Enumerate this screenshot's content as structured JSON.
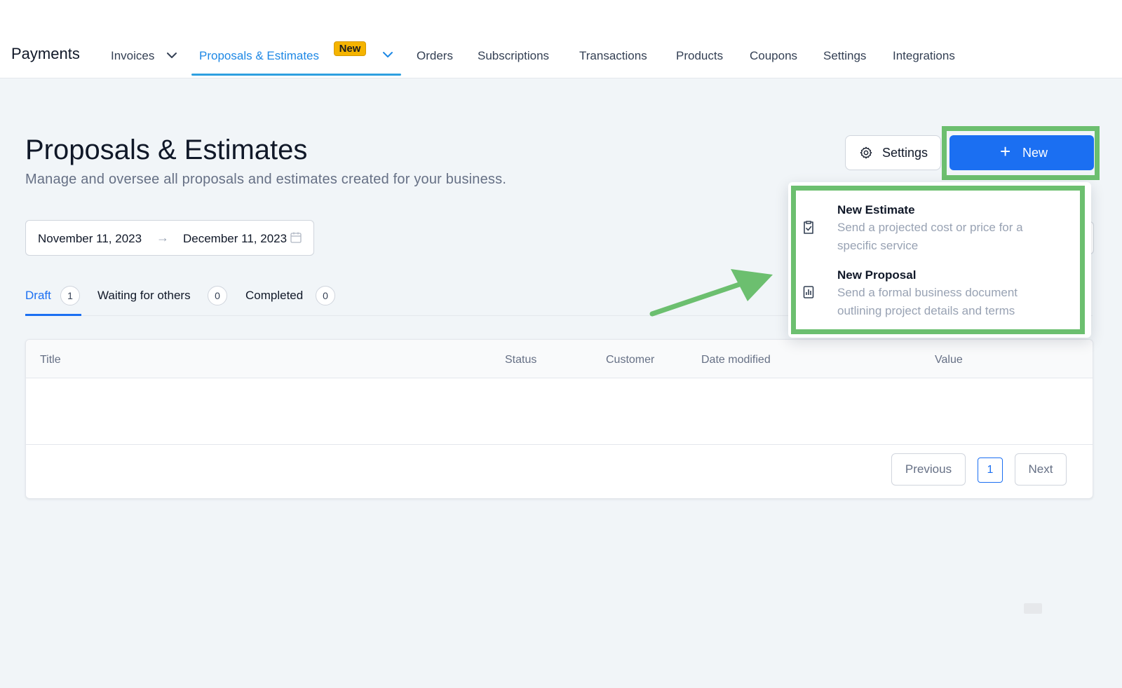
{
  "nav": {
    "brand": "Payments",
    "items": [
      {
        "label": "Invoices"
      },
      {
        "label": "Proposals & Estimates",
        "badge": "New"
      },
      {
        "label": "Orders"
      },
      {
        "label": "Subscriptions"
      },
      {
        "label": "Transactions"
      },
      {
        "label": "Products"
      },
      {
        "label": "Coupons"
      },
      {
        "label": "Settings"
      },
      {
        "label": "Integrations"
      }
    ],
    "active_index": 1
  },
  "header": {
    "title": "Proposals & Estimates",
    "subtitle": "Manage and oversee all proposals and estimates created for your business.",
    "settings_label": "Settings",
    "new_label": "New"
  },
  "date_range": {
    "start": "November 11, 2023",
    "end": "December 11, 2023"
  },
  "tabs": [
    {
      "label": "Draft",
      "count": "1"
    },
    {
      "label": "Waiting for others",
      "count": "0"
    },
    {
      "label": "Completed",
      "count": "0"
    }
  ],
  "table": {
    "columns": [
      "Title",
      "Status",
      "Customer",
      "Date modified",
      "Value"
    ],
    "rows": []
  },
  "pagination": {
    "previous": "Previous",
    "current": "1",
    "next": "Next"
  },
  "new_menu": [
    {
      "title": "New Estimate",
      "description": "Send a projected cost or price for a specific service",
      "icon": "checklist-doc-icon"
    },
    {
      "title": "New Proposal",
      "description": "Send a formal business document outlining project details and terms",
      "icon": "chart-doc-icon"
    }
  ],
  "colors": {
    "primary": "#1b6ff2",
    "nav_active": "#1e88e5",
    "highlight": "#6cbf6f",
    "badge": "#f5b400",
    "background": "#f1f5f8"
  }
}
